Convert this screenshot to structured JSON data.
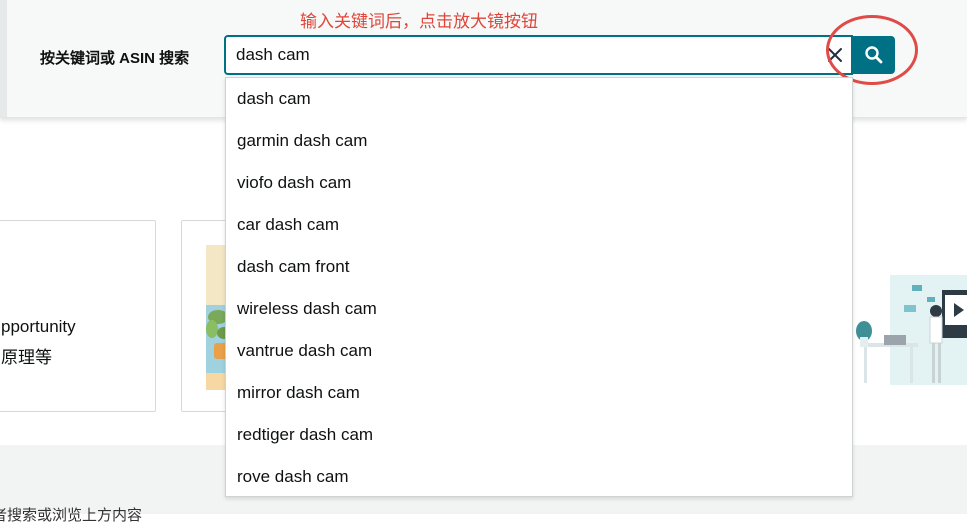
{
  "annotation": {
    "text": "输入关键词后，点击放大镜按钮",
    "color": "#e0453a"
  },
  "search": {
    "label": "按关键词或 ASIN 搜索",
    "value": "dash cam",
    "accent": "#007185",
    "clear_icon": "close-icon",
    "button_icon": "search-icon"
  },
  "suggestions": [
    "dash cam",
    "garmin dash cam",
    "viofo dash cam",
    "car dash cam",
    "dash cam front",
    "wireless dash cam",
    "vantrue dash cam",
    "mirror dash cam",
    "redtiger dash cam",
    "rove dash cam"
  ],
  "cards": {
    "left_line1": "pportunity",
    "left_line2": "原理等"
  },
  "bottom": {
    "text": "者搜索或浏览上方内容"
  }
}
